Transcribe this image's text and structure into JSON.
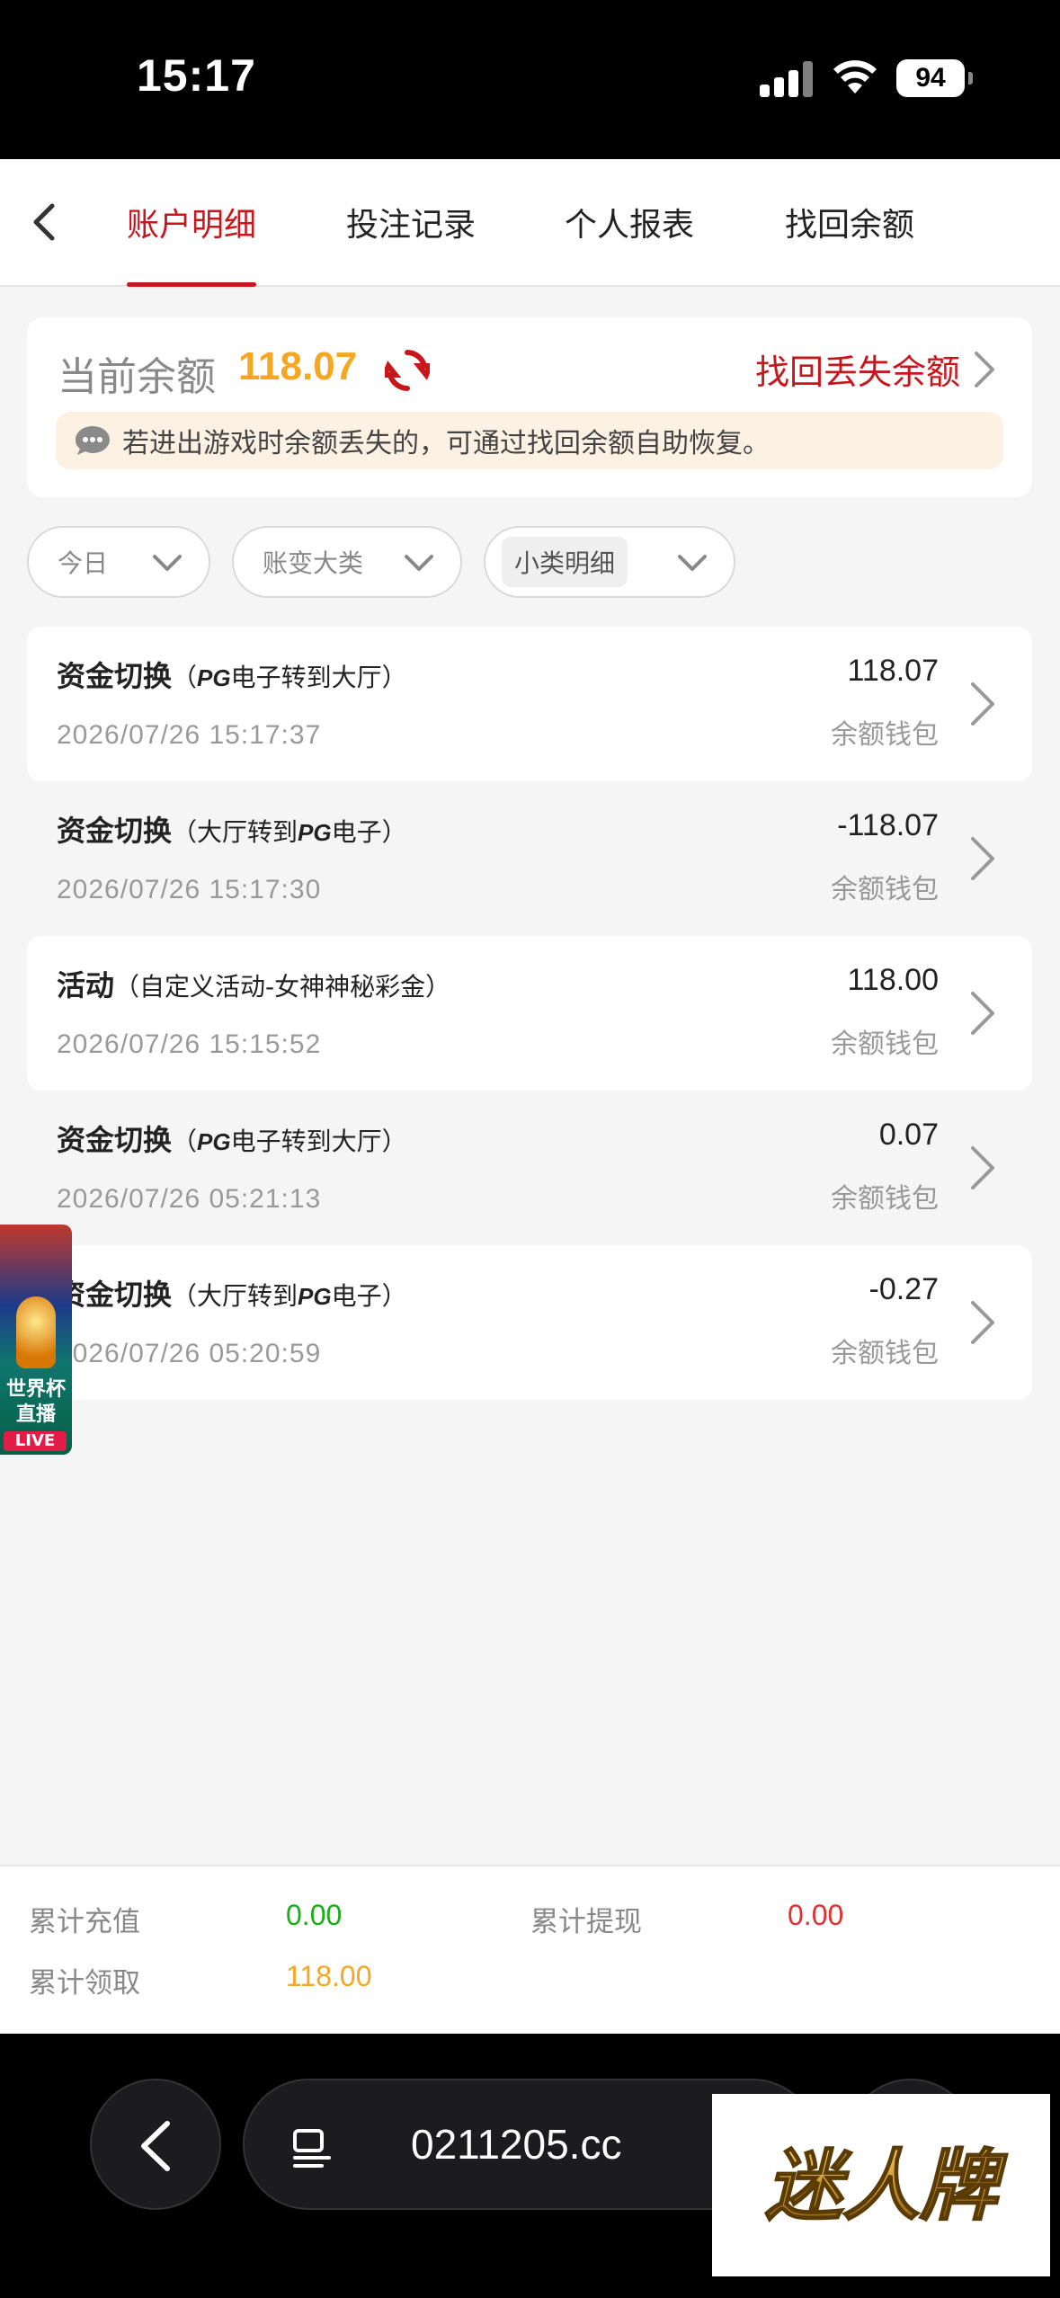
{
  "status": {
    "time": "15:17",
    "battery": "94"
  },
  "tabs": [
    {
      "label": "账户明细",
      "active": true
    },
    {
      "label": "投注记录",
      "active": false
    },
    {
      "label": "个人报表",
      "active": false
    },
    {
      "label": "找回余额",
      "active": false
    }
  ],
  "balance": {
    "label": "当前余额",
    "value": "118.07",
    "recover_link": "找回丢失余额",
    "notice": "若进出游戏时余额丢失的，可通过找回余额自助恢复。"
  },
  "filters": [
    {
      "label": "今日"
    },
    {
      "label": "账变大类"
    },
    {
      "label": "小类明细"
    }
  ],
  "records": [
    {
      "title": "资金切换",
      "detail_pre": "（",
      "pg1": "PG",
      "detail_mid": "电子转到大厅）",
      "pg2": "",
      "detail_post": "",
      "time": "2026/07/26 15:17:37",
      "amount": "118.07",
      "wallet": "余额钱包"
    },
    {
      "title": "资金切换",
      "detail_pre": "（大厅转到",
      "pg1": "",
      "detail_mid": "",
      "pg2": "PG",
      "detail_post": "电子）",
      "time": "2026/07/26 15:17:30",
      "amount": "-118.07",
      "wallet": "余额钱包"
    },
    {
      "title": "活动",
      "detail_pre": "（自定义活动-女神神秘彩金）",
      "pg1": "",
      "detail_mid": "",
      "pg2": "",
      "detail_post": "",
      "time": "2026/07/26 15:15:52",
      "amount": "118.00",
      "wallet": "余额钱包"
    },
    {
      "title": "资金切换",
      "detail_pre": "（",
      "pg1": "PG",
      "detail_mid": "电子转到大厅）",
      "pg2": "",
      "detail_post": "",
      "time": "2026/07/26 05:21:13",
      "amount": "0.07",
      "wallet": "余额钱包"
    },
    {
      "title": "资金切换",
      "detail_pre": "（大厅转到",
      "pg1": "",
      "detail_mid": "",
      "pg2": "PG",
      "detail_post": "电子）",
      "time": "2026/07/26 05:20:59",
      "amount": "-0.27",
      "wallet": "余额钱包"
    }
  ],
  "float_ad": {
    "title_line1": "世界杯",
    "title_line2": "直播",
    "badge": "LIVE"
  },
  "summary": {
    "recharge_label": "累计充值",
    "recharge_value": "0.00",
    "withdraw_label": "累计提现",
    "withdraw_value": "0.00",
    "claim_label": "累计领取",
    "claim_value": "118.00"
  },
  "browser": {
    "url": "0211205.cc"
  },
  "watermark": {
    "text": "迷人牌"
  },
  "colors": {
    "accent": "#c8161d",
    "balance": "#f5a623",
    "green": "#1aad19",
    "red": "#e03131"
  }
}
